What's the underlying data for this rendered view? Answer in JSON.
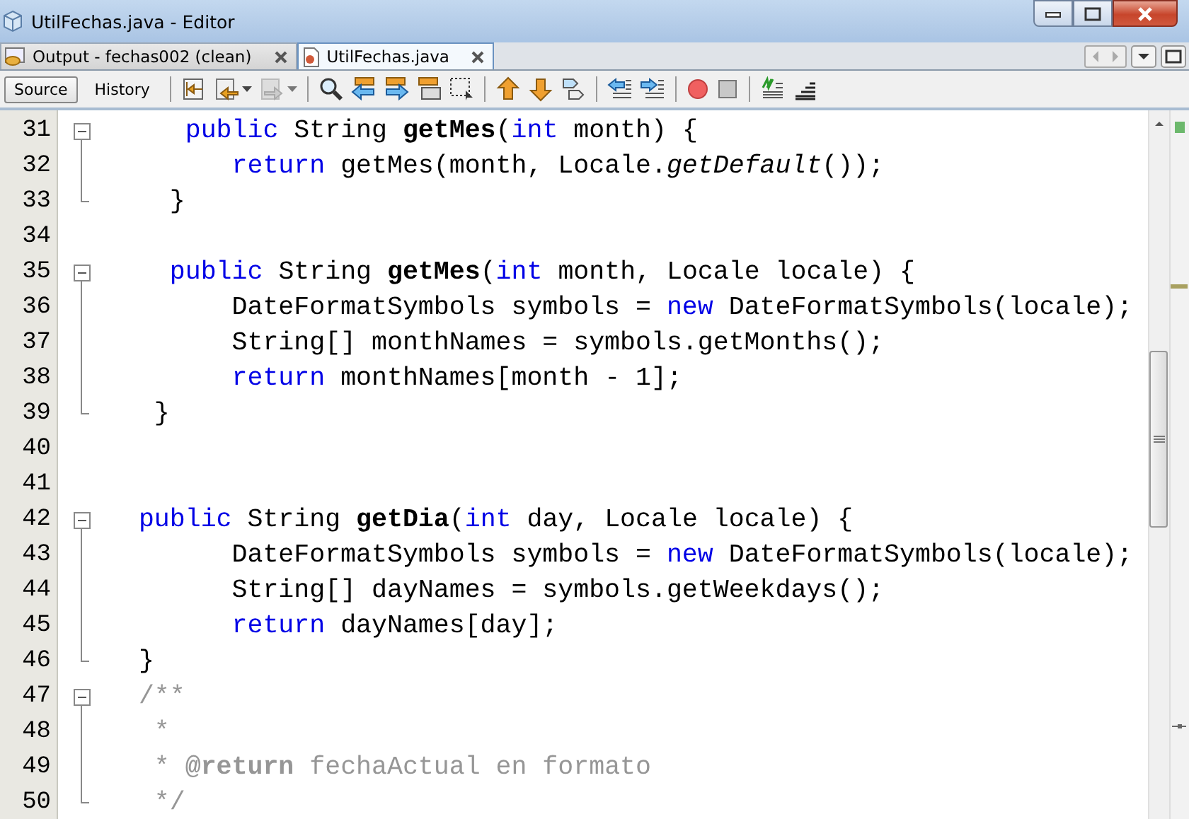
{
  "window": {
    "title": "UtilFechas.java - Editor"
  },
  "tabs": [
    {
      "label": "Output - fechas002 (clean)",
      "selected": false
    },
    {
      "label": "UtilFechas.java",
      "selected": true
    }
  ],
  "view_buttons": [
    {
      "label": "Source",
      "selected": true
    },
    {
      "label": "History",
      "selected": false
    }
  ],
  "lines": [
    {
      "number": "31",
      "tokens": [
        {
          "kind": "kw",
          "text": "     public"
        },
        {
          "kind": "plain",
          "text": " String "
        },
        {
          "kind": "method",
          "text": "getMes"
        },
        {
          "kind": "plain",
          "text": "("
        },
        {
          "kind": "kw",
          "text": "int"
        },
        {
          "kind": "plain",
          "text": " month) {"
        }
      ],
      "children": [
        {
          "number": "32",
          "tokens": [
            {
              "kind": "kw",
              "text": "        return"
            },
            {
              "kind": "plain",
              "text": " getMes(month, Locale."
            },
            {
              "kind": "static",
              "text": "getDefault"
            },
            {
              "kind": "plain",
              "text": "());"
            }
          ]
        },
        {
          "number": "33",
          "tokens": [
            {
              "kind": "plain",
              "text": "    }"
            }
          ]
        }
      ]
    },
    {
      "number": "34"
    },
    {
      "number": "35",
      "tokens": [
        {
          "kind": "kw",
          "text": "    public"
        },
        {
          "kind": "plain",
          "text": " String "
        },
        {
          "kind": "method",
          "text": "getMes"
        },
        {
          "kind": "plain",
          "text": "("
        },
        {
          "kind": "kw",
          "text": "int"
        },
        {
          "kind": "plain",
          "text": " month, Locale locale) {"
        }
      ],
      "children": [
        {
          "number": "36",
          "tokens": [
            {
              "kind": "plain",
              "text": "        DateFormatSymbols symbols = "
            },
            {
              "kind": "kw",
              "text": "new"
            },
            {
              "kind": "plain",
              "text": " DateFormatSymbols(locale);"
            }
          ]
        },
        {
          "number": "37",
          "tokens": [
            {
              "kind": "plain",
              "text": "        String[] monthNames = symbols.getMonths();"
            }
          ]
        },
        {
          "number": "38",
          "tokens": [
            {
              "kind": "kw",
              "text": "        return"
            },
            {
              "kind": "plain",
              "text": " monthNames[month - 1];"
            }
          ]
        },
        {
          "number": "39",
          "tokens": [
            {
              "kind": "plain",
              "text": "   }"
            }
          ]
        }
      ]
    },
    {
      "number": "40"
    },
    {
      "number": "41"
    },
    {
      "number": "42",
      "tokens": [
        {
          "kind": "kw",
          "text": "  public"
        },
        {
          "kind": "plain",
          "text": " String "
        },
        {
          "kind": "method",
          "text": "getDia"
        },
        {
          "kind": "plain",
          "text": "("
        },
        {
          "kind": "kw",
          "text": "int"
        },
        {
          "kind": "plain",
          "text": " day, Locale locale) {"
        }
      ],
      "children": [
        {
          "number": "43",
          "tokens": [
            {
              "kind": "plain",
              "text": "        DateFormatSymbols symbols = "
            },
            {
              "kind": "kw",
              "text": "new"
            },
            {
              "kind": "plain",
              "text": " DateFormatSymbols(locale);"
            }
          ]
        },
        {
          "number": "44",
          "tokens": [
            {
              "kind": "plain",
              "text": "        String[] dayNames = symbols.getWeekdays();"
            }
          ]
        },
        {
          "number": "45",
          "tokens": [
            {
              "kind": "kw",
              "text": "        return"
            },
            {
              "kind": "plain",
              "text": " dayNames[day];"
            }
          ]
        },
        {
          "number": "46",
          "tokens": [
            {
              "kind": "plain",
              "text": "  }"
            }
          ]
        }
      ]
    },
    {
      "number": "47",
      "tokens": [
        {
          "kind": "comment",
          "text": "  /**"
        }
      ],
      "children": [
        {
          "number": "48",
          "tokens": [
            {
              "kind": "comment",
              "text": "   *"
            }
          ]
        },
        {
          "number": "49",
          "tokens": [
            {
              "kind": "comment",
              "text": "   * "
            },
            {
              "kind": "tag",
              "text": "@return"
            },
            {
              "kind": "comment",
              "text": " fechaActual en formato"
            }
          ]
        },
        {
          "number": "50",
          "tokens": [
            {
              "kind": "comment",
              "text": "   */"
            }
          ]
        }
      ]
    }
  ]
}
